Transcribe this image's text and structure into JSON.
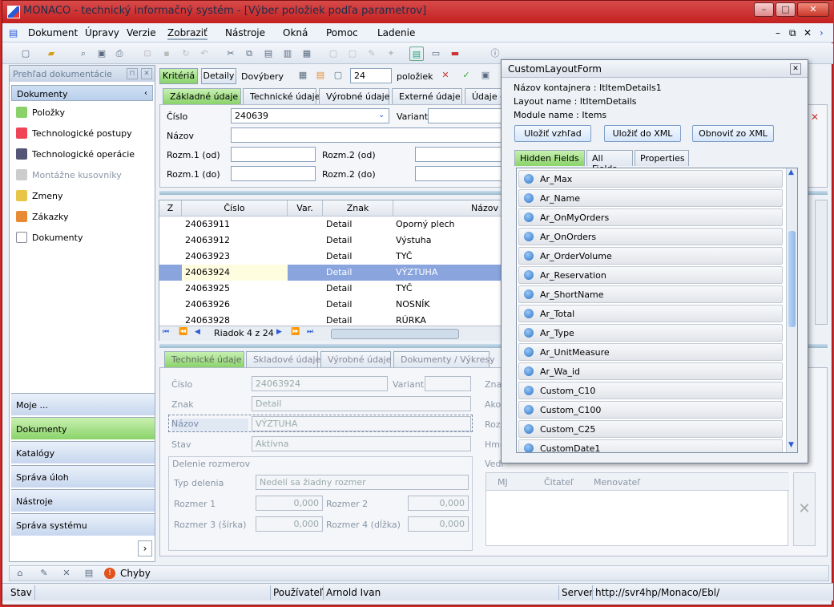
{
  "window": {
    "title": "MONACO - technický informačný systém - [Výber položiek podľa parametrov]"
  },
  "menu": [
    "Dokument",
    "Úpravy",
    "Verzie",
    "Zobraziť",
    "Nástroje",
    "Okná",
    "Pomoc",
    "Ladenie"
  ],
  "left_panel": {
    "header": "Prehľad dokumentácie",
    "section": "Dokumenty",
    "items": [
      "Položky",
      "Technologické postupy",
      "Technologické operácie",
      "Montážne kusovníky",
      "Zmeny",
      "Zákazky",
      "Dokumenty"
    ],
    "nav": [
      "Moje ...",
      "Dokumenty",
      "Katalógy",
      "Správa úloh",
      "Nástroje",
      "Správa systému"
    ]
  },
  "filter": {
    "buttons": [
      "Kritériá",
      "Detaily",
      "Dovýbery"
    ],
    "count": "24",
    "count_label": "položiek",
    "tabs": [
      "Základné údaje",
      "Technické údaje",
      "Výrobné údaje",
      "Externé údaje",
      "Údaje o"
    ],
    "labels": {
      "cislo": "Číslo",
      "variant": "Variant",
      "nazov": "Názov",
      "rozm1od": "Rozm.1 (od)",
      "rozm2od": "Rozm.2 (od)",
      "rozm1do": "Rozm.1 (do)",
      "rozm2do": "Rozm.2 (do)"
    },
    "cislo_value": "240639"
  },
  "grid": {
    "headers": [
      "Z",
      "Číslo",
      "Var.",
      "Znak",
      "Názov"
    ],
    "rows": [
      [
        "24063911",
        "Detail",
        "Oporný plech"
      ],
      [
        "24063912",
        "Detail",
        "Výstuha"
      ],
      [
        "24063923",
        "Detail",
        "TYČ"
      ],
      [
        "24063924",
        "Detail",
        "VÝZTUHA"
      ],
      [
        "24063925",
        "Detail",
        "TYČ"
      ],
      [
        "24063926",
        "Detail",
        "NOSNÍK"
      ],
      [
        "24063928",
        "Detail",
        "RÚRKA"
      ]
    ],
    "pager": "Riadok 4 z 24"
  },
  "detail": {
    "tabs": [
      "Technické údaje",
      "Skladové údaje",
      "Výrobné údaje",
      "Dokumenty / Výkresy"
    ],
    "labels": {
      "cislo": "Číslo",
      "variant": "Variant",
      "znak": "Znak",
      "nazov": "Názov",
      "stav": "Stav",
      "delenie": "Delenie rozmerov",
      "typ": "Typ delenia",
      "r1": "Rozmer 1",
      "r2": "Rozmer 2",
      "r3": "Rozmer 3 (šírka)",
      "r4": "Rozmer 4 (dĺžka)"
    },
    "values": {
      "cislo": "24063924",
      "znak": "Detail",
      "nazov": "VÝZTUHA",
      "stav": "Aktívna",
      "typ": "Nedelí sa žiadny rozmer",
      "r1": "0,000",
      "r2": "0,000",
      "r3": "0,000",
      "r4": "0,000"
    },
    "side_labels": [
      "Znač",
      "Akos",
      "Rozm",
      "Hmo"
    ],
    "ved_label": "Vedľ",
    "ved_headers": [
      "MJ",
      "Čitateľ",
      "Menovateľ"
    ]
  },
  "bottom_toolbar": {
    "chyby": "Chyby"
  },
  "status": {
    "stav": "Stav",
    "user_label": "Používateľ",
    "user": "Arnold Ivan",
    "server_label": "Server",
    "server": "http://svr4hp/Monaco/Ebl/"
  },
  "dialog": {
    "title": "CustomLayoutForm",
    "container": "Názov kontajnera : ItItemDetails1",
    "layout": "Layout name : ItItemDetails",
    "module": "Module name : Items",
    "buttons": [
      "Uložiť vzhľad",
      "Uložiť do XML",
      "Obnoviť zo XML"
    ],
    "tabs": [
      "Hidden Fields",
      "All Fields",
      "Properties"
    ],
    "fields": [
      "Ar_Max",
      "Ar_Name",
      "Ar_OnMyOrders",
      "Ar_OnOrders",
      "Ar_OrderVolume",
      "Ar_Reservation",
      "Ar_ShortName",
      "Ar_Total",
      "Ar_Type",
      "Ar_UnitMeasure",
      "Ar_Wa_id",
      "Custom_C10",
      "Custom_C100",
      "Custom_C25",
      "CustomDate1"
    ]
  }
}
